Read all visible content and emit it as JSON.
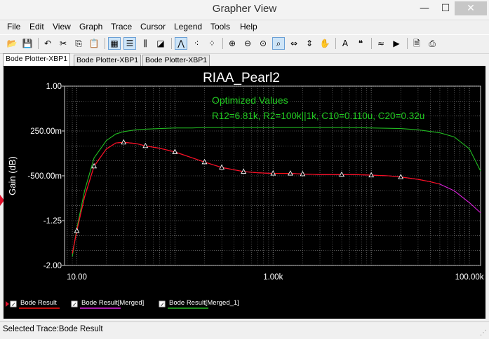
{
  "window": {
    "title": "Grapher View",
    "min_glyph": "—",
    "max_glyph": "☐",
    "close_glyph": "✕"
  },
  "menu": [
    "File",
    "Edit",
    "View",
    "Graph",
    "Trace",
    "Cursor",
    "Legend",
    "Tools",
    "Help"
  ],
  "toolbar": {
    "icons": [
      "open-icon",
      "save-icon",
      "sep",
      "undo-icon",
      "cut-icon",
      "copy-icon",
      "paste-icon",
      "sep",
      "grid-icon",
      "legend-icon",
      "cursors-icon",
      "reverse-colors-icon",
      "sep",
      "show-cursors-icon",
      "select-marks-icon",
      "select-marks-alt-icon",
      "sep",
      "zoom-in-icon",
      "zoom-out-icon",
      "zoom-full-icon",
      "zoom-area-icon",
      "zoom-x-icon",
      "zoom-y-icon",
      "pan-icon",
      "sep",
      "text-icon",
      "overlay-icon",
      "sep",
      "add-trace-icon",
      "export-icon",
      "sep",
      "print-preview-icon",
      "print-icon"
    ],
    "glyphs": [
      "📂",
      "💾",
      "",
      "↶",
      "✂",
      "⎘",
      "📋",
      "",
      "▦",
      "☰",
      "⫼",
      "◪",
      "",
      "⋀",
      "⁖",
      "⁘",
      "",
      "⊕",
      "⊖",
      "⊙",
      "⌕",
      "⇔",
      "⇕",
      "✋",
      "",
      "A",
      "❝",
      "",
      "≈",
      "▶",
      "",
      "🗎",
      "⎙"
    ]
  },
  "tabs": [
    "Bode Plotter-XBP1",
    "Bode Plotter-XBP1",
    "Bode Plotter-XBP1"
  ],
  "plot": {
    "title": "RIAA_Pearl2",
    "annotation_line1": "Optimized Values",
    "annotation_line2": "R12=6.81k, R2=100k||1k, C10=0.110u, C20=0.32u",
    "annotation_color": "#22cc22",
    "background_color": "#000000"
  },
  "status": {
    "text": "Selected Trace:Bode Result"
  },
  "chart_data": {
    "type": "line",
    "title": "RIAA_Pearl2",
    "xlabel": "",
    "ylabel": "Gain (dB)",
    "x_scale": "log",
    "xlim": [
      7.5,
      130000
    ],
    "ylim": [
      -2.0,
      1.0
    ],
    "x_ticks": [
      10,
      1000,
      100000
    ],
    "x_tick_labels": [
      "10.00",
      "1.00k",
      "100.00k"
    ],
    "y_ticks": [
      1.0,
      0.25,
      -0.5,
      -1.25,
      -2.0
    ],
    "y_tick_labels": [
      "1.00",
      "250.00m",
      "-500.00m",
      "-1.25",
      "-2.00"
    ],
    "grid": true,
    "legend": "bottom-left",
    "series": [
      {
        "name": "Bode Result",
        "color": "#ff1010",
        "x": [
          9,
          10,
          12,
          15,
          20,
          25,
          30,
          40,
          50,
          70,
          100,
          150,
          200,
          300,
          500,
          700,
          1000,
          1500,
          2000,
          3000,
          5000,
          7000,
          10000,
          15000,
          20000,
          30000,
          40000,
          50000
        ],
        "y": [
          -1.8,
          -1.42,
          -0.85,
          -0.34,
          -0.05,
          0.05,
          0.06,
          0.04,
          0.0,
          -0.04,
          -0.1,
          -0.2,
          -0.27,
          -0.36,
          -0.43,
          -0.45,
          -0.46,
          -0.46,
          -0.47,
          -0.48,
          -0.48,
          -0.48,
          -0.49,
          -0.5,
          -0.52,
          -0.56,
          -0.6,
          -0.64
        ]
      },
      {
        "name": "Bode Result[Merged]",
        "color": "#e020e0",
        "x": [
          9,
          10,
          12,
          15,
          20,
          25,
          30,
          40,
          50,
          70,
          100,
          150,
          200,
          300,
          500,
          700,
          1000,
          1500,
          2000,
          3000,
          5000,
          7000,
          10000,
          15000,
          20000,
          30000,
          40000,
          50000,
          70000,
          100000,
          130000
        ],
        "y": [
          -1.8,
          -1.42,
          -0.85,
          -0.34,
          -0.05,
          0.05,
          0.06,
          0.04,
          0.0,
          -0.04,
          -0.1,
          -0.2,
          -0.27,
          -0.36,
          -0.43,
          -0.45,
          -0.46,
          -0.46,
          -0.47,
          -0.48,
          -0.48,
          -0.48,
          -0.49,
          -0.5,
          -0.52,
          -0.56,
          -0.6,
          -0.64,
          -0.75,
          -0.95,
          -1.12
        ]
      },
      {
        "name": "Bode Result[Merged_1]",
        "color": "#22bb22",
        "x": [
          9,
          10,
          12,
          15,
          20,
          25,
          30,
          40,
          50,
          70,
          100,
          150,
          200,
          300,
          500,
          1000,
          2000,
          5000,
          10000,
          20000,
          30000,
          50000,
          70000,
          100000,
          130000
        ],
        "y": [
          -1.85,
          -1.38,
          -0.75,
          -0.2,
          0.09,
          0.2,
          0.24,
          0.27,
          0.28,
          0.29,
          0.3,
          0.3,
          0.31,
          0.31,
          0.31,
          0.31,
          0.31,
          0.31,
          0.3,
          0.29,
          0.27,
          0.22,
          0.15,
          -0.05,
          -0.42
        ]
      }
    ],
    "markers": {
      "x": [
        10,
        15,
        30,
        50,
        100,
        200,
        300,
        500,
        1000,
        1500,
        2000,
        5000,
        10000,
        20000
      ],
      "y": [
        -1.42,
        -0.34,
        0.06,
        0.0,
        -0.1,
        -0.27,
        -0.36,
        -0.43,
        -0.46,
        -0.46,
        -0.47,
        -0.48,
        -0.49,
        -0.52
      ]
    },
    "legend_entries": [
      "Bode Result",
      "Bode Result[Merged]",
      "Bode Result[Merged_1]"
    ]
  }
}
